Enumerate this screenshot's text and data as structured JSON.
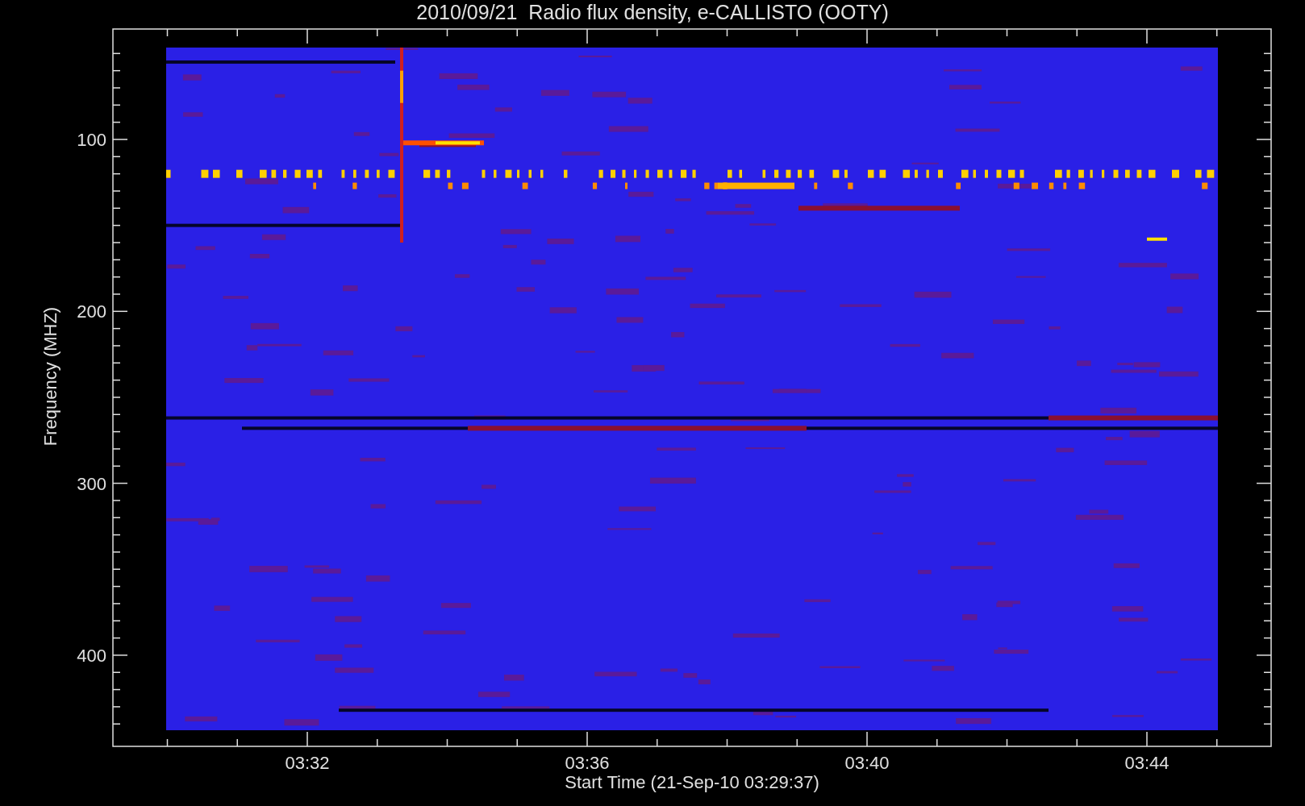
{
  "title": "2010/09/21  Radio flux density, e-CALLISTO (OOTY)",
  "plot": {
    "ylabel": "Frequency (MHZ)",
    "xlabel": "Start Time (21-Sep-10 03:29:37)",
    "yticks": [
      "100",
      "200",
      "300",
      "400"
    ],
    "xticks": [
      "03:32",
      "03:36",
      "03:40",
      "03:44"
    ]
  }
}
